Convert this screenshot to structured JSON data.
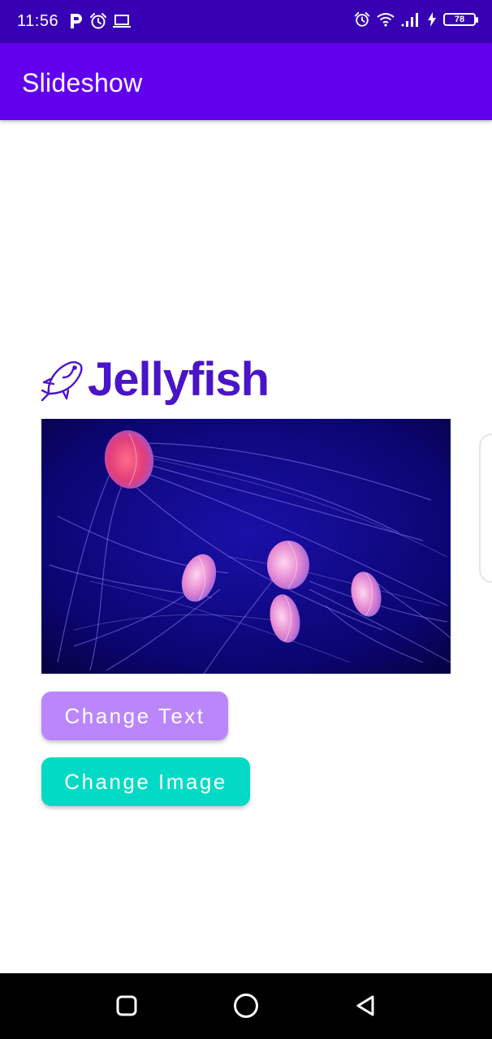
{
  "status_bar": {
    "time": "11:56",
    "battery_level": "78",
    "left_icons": [
      "parking-icon",
      "alarm-icon",
      "laptop-icon"
    ],
    "right_icons": [
      "alarm-icon",
      "wifi-icon",
      "signal-icon",
      "charging-icon",
      "battery-icon"
    ]
  },
  "app_bar": {
    "title": "Slideshow",
    "color": "#6200ee",
    "status_color": "#3700b3"
  },
  "slide": {
    "title": "Jellyfish",
    "title_color": "#4a14c8",
    "title_icon": "fish-icon",
    "image": "jellyfish-photo"
  },
  "buttons": {
    "change_text_label": "Change Text",
    "change_text_color": "#bb86fc",
    "change_image_label": "Change Image",
    "change_image_color": "#03dac5"
  },
  "navigation": {
    "items": [
      "recents-icon",
      "home-icon",
      "back-icon"
    ]
  }
}
